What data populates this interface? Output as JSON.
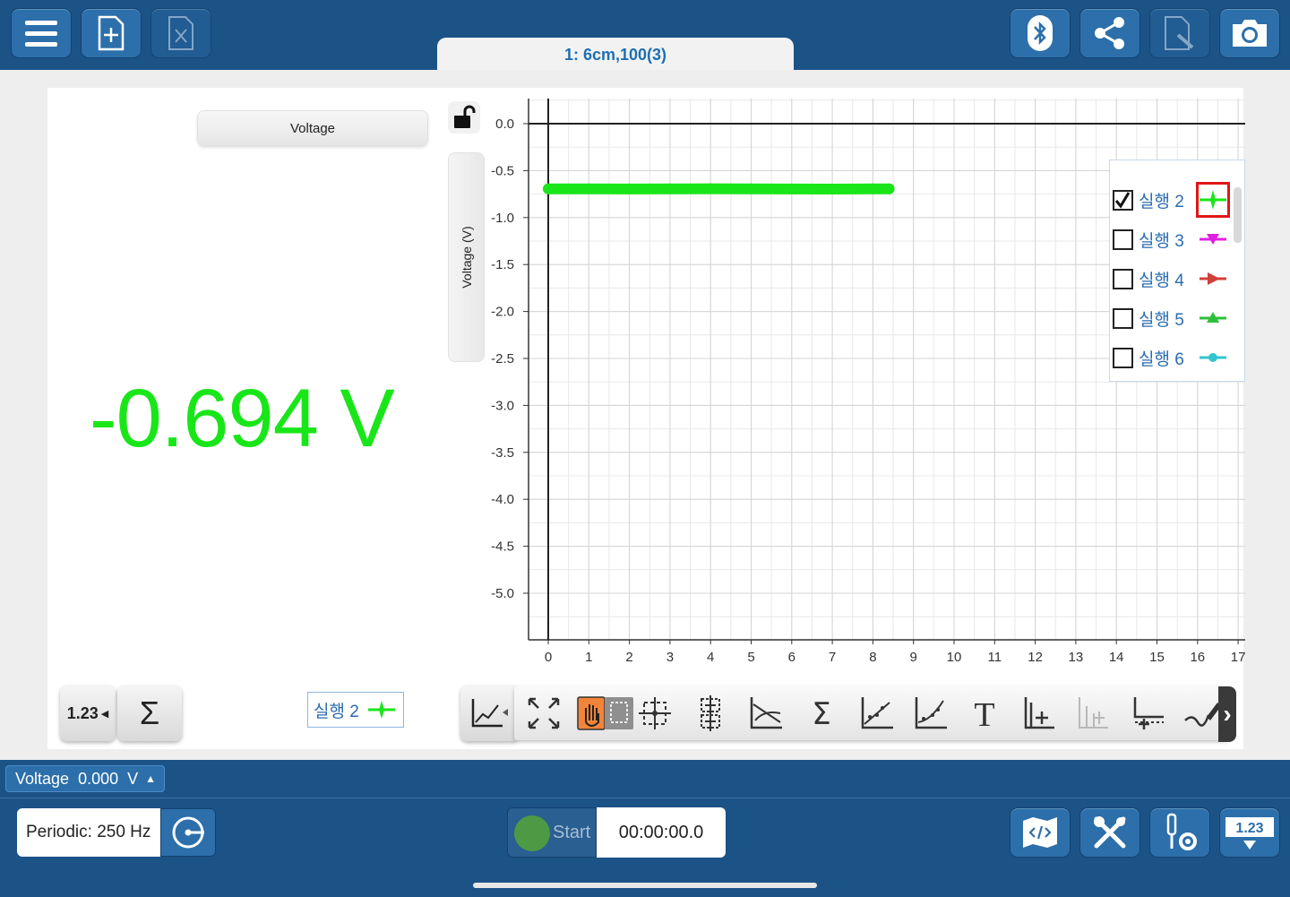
{
  "topbar": {
    "buttons": [
      {
        "name": "menu-button",
        "icon": "hamburger-icon"
      },
      {
        "name": "new-page-button",
        "icon": "add-page-icon"
      },
      {
        "name": "delete-page-button",
        "icon": "delete-page-icon"
      },
      {
        "name": "bluetooth-button",
        "icon": "bluetooth-icon"
      },
      {
        "name": "share-button",
        "icon": "share-icon"
      },
      {
        "name": "annotate-button",
        "icon": "edit-page-icon"
      },
      {
        "name": "camera-button",
        "icon": "camera-icon"
      }
    ]
  },
  "tab": {
    "title": "1: 6cm,100(3)"
  },
  "meter": {
    "header": "Voltage",
    "value": "-0.694 V",
    "color": "#19e619"
  },
  "graph": {
    "y_axis_label": "Voltage (V)"
  },
  "chart_data": {
    "type": "line",
    "x": [
      0,
      1,
      2,
      3,
      4,
      5,
      6,
      7,
      8,
      8.4
    ],
    "series": [
      {
        "name": "실행 2",
        "color": "#19e619",
        "values": [
          -0.694,
          -0.694,
          -0.695,
          -0.694,
          -0.693,
          -0.694,
          -0.695,
          -0.696,
          -0.694,
          -0.694
        ]
      }
    ],
    "xlim": [
      0,
      17
    ],
    "ylim": [
      -5.0,
      0.0
    ],
    "x_ticks": [
      "0",
      "1",
      "2",
      "3",
      "4",
      "5",
      "6",
      "7",
      "8",
      "9",
      "10",
      "11",
      "12",
      "13",
      "14",
      "15",
      "16",
      "17"
    ],
    "y_ticks": [
      "0.0",
      "-0.5",
      "-1.0",
      "-1.5",
      "-2.0",
      "-2.5",
      "-3.0",
      "-3.5",
      "-4.0",
      "-4.5",
      "-5.0"
    ],
    "ylabel": "Voltage (V)",
    "grid": true,
    "legend": "top-right"
  },
  "legend": {
    "items": [
      {
        "label": "실행 2",
        "checked": true,
        "color": "#19e619",
        "selected": true
      },
      {
        "label": "실행 3",
        "checked": false,
        "color": "#e020e0",
        "selected": false
      },
      {
        "label": "실행 4",
        "checked": false,
        "color": "#d0403a",
        "selected": false
      },
      {
        "label": "실행 5",
        "checked": false,
        "color": "#2ebf3a",
        "selected": false
      },
      {
        "label": "실행 6",
        "checked": false,
        "color": "#33c4d0",
        "selected": false
      }
    ]
  },
  "bottom_tools": {
    "digits_label": "1.23",
    "sum_label": "Σ",
    "run_label": "실행 2"
  },
  "graph_toolbar": {
    "tools": [
      "fit-icon",
      "pan-select-icon",
      "crosshair-icon",
      "tangent-icon",
      "slope-icon",
      "integral-icon",
      "curve-fit-icon",
      "curve-fit2-icon",
      "text-icon",
      "add-axis-icon",
      "add-axis-disabled-icon",
      "add-series-icon",
      "draw-icon"
    ],
    "text_tool_label": "T"
  },
  "status": {
    "sensor": "Voltage",
    "sensor_value": "0.000",
    "sensor_unit": "V",
    "rate": "Periodic: 250 Hz",
    "start_label": "Start",
    "timer": "00:00:00.0",
    "display_btn_label": "1.23"
  }
}
